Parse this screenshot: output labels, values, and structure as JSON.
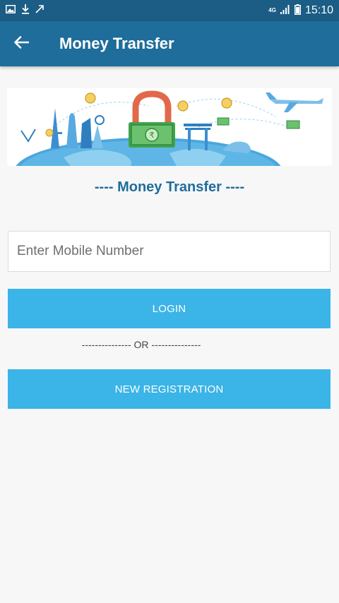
{
  "status_bar": {
    "network": "4G",
    "time": "15:10"
  },
  "app_bar": {
    "title": "Money Transfer"
  },
  "main": {
    "subtitle": "----  Money Transfer ----",
    "mobile_input": {
      "value": "",
      "placeholder": "Enter Mobile Number"
    },
    "login_label": "LOGIN",
    "or_label": "--------------- OR ---------------",
    "register_label": "NEW REGISTRATION"
  },
  "colors": {
    "status_bar": "#1b5d85",
    "app_bar": "#1f6d9b",
    "button": "#3bb4e7",
    "subtitle": "#1f6d9b",
    "background": "#f7f7f8"
  },
  "icons": {
    "status_left": [
      "image-icon",
      "download-icon",
      "signal-arrow-icon"
    ],
    "status_right": [
      "signal-bars-icon",
      "battery-icon"
    ],
    "app_bar": "back-arrow-icon"
  }
}
